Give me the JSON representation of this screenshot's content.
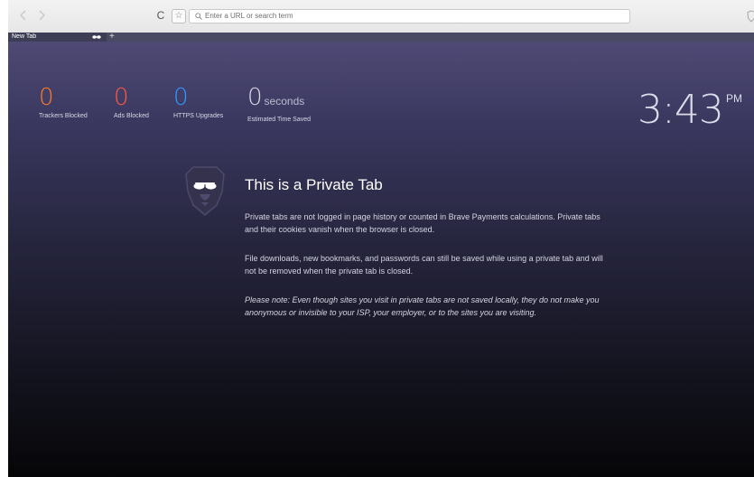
{
  "toolbar": {
    "back_icon": "chevron-left-icon",
    "forward_icon": "chevron-right-icon",
    "reload_glyph": "C",
    "bookmark_glyph": "☆",
    "url_placeholder": "Enter a URL or search term"
  },
  "tabs": [
    {
      "title": "New Tab"
    }
  ],
  "new_tab_label": "+",
  "stats": {
    "trackers": {
      "value": "0",
      "label": "Trackers Blocked",
      "color": "#fe7b2b"
    },
    "ads": {
      "value": "0",
      "label": "Ads Blocked",
      "color": "#fe5b42"
    },
    "https": {
      "value": "0",
      "label": "HTTPS Upgrades",
      "color": "#2c9aff"
    },
    "time": {
      "value": "0",
      "unit": "seconds",
      "label": "Estimated Time Saved"
    }
  },
  "clock": {
    "time": "3:43",
    "ampm": "PM"
  },
  "private": {
    "title": "This is a Private Tab",
    "para1": "Private tabs are not logged in page history or counted in Brave Payments calculations. Private tabs and their cookies vanish when the browser is closed.",
    "para2": "File downloads, new bookmarks, and passwords can still be saved while using a private tab and will not be removed when the private tab is closed.",
    "para3": "Please note: Even though sites you visit in private tabs are not saved locally, they do not make you anonymous or invisible to your ISP, your employer, or to the sites you are visiting."
  }
}
